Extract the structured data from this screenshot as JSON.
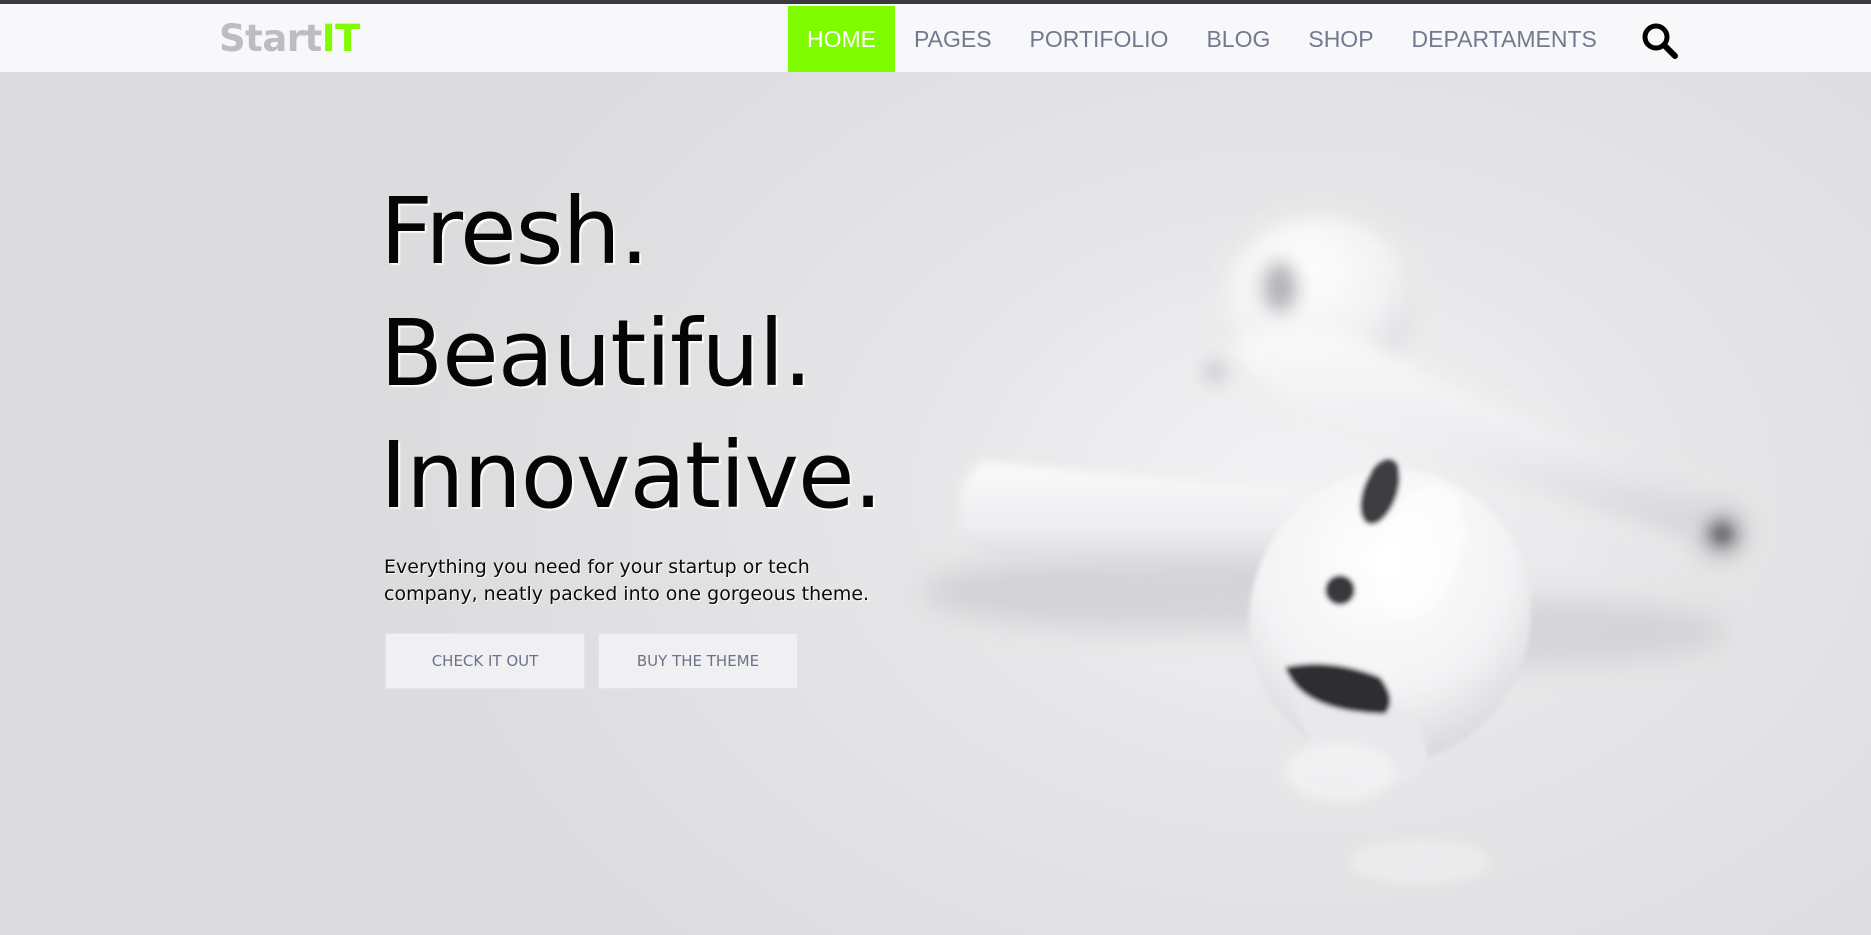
{
  "header": {
    "logo": {
      "part1": "Start",
      "part2": "IT"
    },
    "nav": [
      {
        "label": "HOME",
        "active": true
      },
      {
        "label": "PAGES",
        "active": false
      },
      {
        "label": "PORTIFOLIO",
        "active": false
      },
      {
        "label": "BLOG",
        "active": false
      },
      {
        "label": "SHOP",
        "active": false
      },
      {
        "label": "DEPARTAMENTS",
        "active": false
      }
    ],
    "search_icon": "search-icon"
  },
  "hero": {
    "headline": [
      "Fresh.",
      "Beautiful.",
      "Innovative."
    ],
    "subtitle_line1": "Everything you need for your startup or tech",
    "subtitle_line2": "company, neatly packed into one gorgeous theme.",
    "buttons": [
      {
        "label": "CHECK IT OUT"
      },
      {
        "label": "BUY THE THEME"
      }
    ],
    "image": "earbuds-photo"
  },
  "colors": {
    "accent": "#7ffc00",
    "nav_text": "#737a8e",
    "logo_gray": "#bdbdc1",
    "headline": "#050505"
  }
}
